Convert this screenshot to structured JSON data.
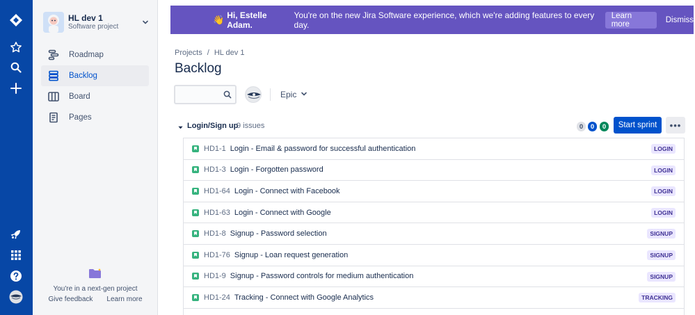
{
  "project": {
    "name": "HL dev 1",
    "type": "Software project"
  },
  "sidebar": {
    "items": [
      {
        "label": "Roadmap",
        "icon": "roadmap-icon",
        "active": false
      },
      {
        "label": "Backlog",
        "icon": "backlog-icon",
        "active": true
      },
      {
        "label": "Board",
        "icon": "board-icon",
        "active": false
      },
      {
        "label": "Pages",
        "icon": "pages-icon",
        "active": false
      }
    ],
    "nextgen_text": "You're in a next-gen project",
    "give_feedback": "Give feedback",
    "learn_more": "Learn more"
  },
  "banner": {
    "greeting": "Hi, Estelle Adam.",
    "message": "You're on the new Jira Software experience, which we're adding features to every day.",
    "learn_more": "Learn more",
    "dismiss": "Dismiss",
    "color": "#6554c0"
  },
  "breadcrumb": {
    "root": "Projects",
    "sep": "/",
    "project": "HL dev 1"
  },
  "page_title": "Backlog",
  "filters": {
    "search_placeholder": "",
    "epic_label": "Epic"
  },
  "sprint": {
    "name": "Login/Sign up",
    "issue_count": "9 issues",
    "todo": "0",
    "in_progress": "0",
    "done": "0",
    "start_label": "Start sprint",
    "more_label": "•••"
  },
  "issues": [
    {
      "key": "HD1-1",
      "summary": "Login - Email & password for successful authentication",
      "label": "LOGIN"
    },
    {
      "key": "HD1-3",
      "summary": "Login - Forgotten password",
      "label": "LOGIN"
    },
    {
      "key": "HD1-64",
      "summary": "Login - Connect with Facebook",
      "label": "LOGIN"
    },
    {
      "key": "HD1-63",
      "summary": "Login - Connect with Google",
      "label": "LOGIN"
    },
    {
      "key": "HD1-8",
      "summary": "Signup - Password selection",
      "label": "SIGNUP"
    },
    {
      "key": "HD1-76",
      "summary": "Signup - Loan request generation",
      "label": "SIGNUP"
    },
    {
      "key": "HD1-9",
      "summary": "Signup - Password controls for medium authentication",
      "label": "SIGNUP"
    },
    {
      "key": "HD1-24",
      "summary": "Tracking - Connect with Google Analytics",
      "label": "TRACKING"
    },
    {
      "key": "",
      "summary": "",
      "label": ""
    }
  ],
  "colors": {
    "nav_rail": "#0747a6",
    "primary": "#0052cc",
    "story": "#36b37e",
    "label_bg": "#eae6ff",
    "label_fg": "#403294"
  }
}
